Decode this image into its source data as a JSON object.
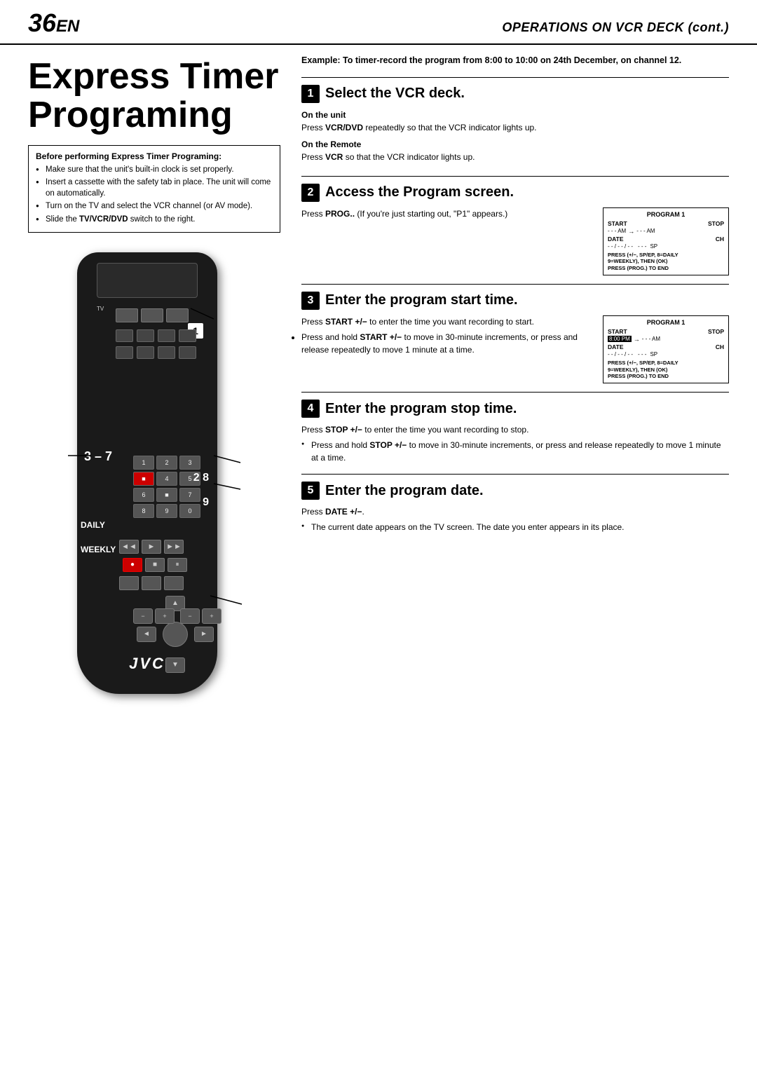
{
  "header": {
    "page_number": "36",
    "page_suffix": "EN",
    "section_title": "OPERATIONS ON VCR DECK (cont.)"
  },
  "page_title": "Express Timer\nPrograming",
  "before_box": {
    "title": "Before performing Express Timer Programing:",
    "items": [
      "Make sure that the unit's built-in clock is set properly.",
      "Insert a cassette with the safety tab in place. The unit will come on automatically.",
      "Turn on the TV and select the VCR channel (or AV mode).",
      "Slide the TV/VCR/DVD switch to the right."
    ]
  },
  "example_text": "Example: To timer-record the program from 8:00 to 10:00 on 24th December, on channel 12.",
  "remote": {
    "labels": {
      "tv": "TV",
      "num1": "1",
      "num3_7": "3 - 7",
      "num2_8": "2  8",
      "num9": "9",
      "daily": "DAILY",
      "weekly": "WEEKLY",
      "num8_bottom": "8",
      "jvc": "JVC"
    },
    "numpad": [
      "1",
      "2",
      "3",
      "4",
      "5",
      "6",
      "7",
      "8",
      "9",
      "0"
    ]
  },
  "steps": [
    {
      "number": "1",
      "title": "Select the VCR deck.",
      "sections": [
        {
          "subtitle": "On the unit",
          "text": "Press VCR/DVD repeatedly so that the VCR indicator lights up."
        },
        {
          "subtitle": "On the Remote",
          "text": "Press VCR so that the VCR indicator lights up."
        }
      ]
    },
    {
      "number": "2",
      "title": "Access the Program screen.",
      "text": "Press PROG.. (If you're just starting out, \"P1\" appears.)",
      "screen": {
        "title": "PROGRAM 1",
        "start_label": "START",
        "stop_label": "STOP",
        "date_label": "DATE",
        "ch_label": "CH",
        "start_val": "- - - AM",
        "stop_val": "- - - AM",
        "date_val": "- - / - - / - -",
        "ch_val": "- - -",
        "sp_val": "SP",
        "bottom": "PRESS (+/−, SP/EP, 8=DAILY\n9=WEEKLY), THEN (OK)\nPRESS (PROG.) TO END"
      }
    },
    {
      "number": "3",
      "title": "Enter the program start time.",
      "text": "Press START +/− to enter the time you want recording to start.",
      "bullets": [
        "Press and hold START +/− to move in 30-minute increments, or press and release repeatedly to move 1 minute at a time."
      ],
      "screen": {
        "title": "PROGRAM 1",
        "start_label": "START",
        "stop_label": "STOP",
        "date_label": "DATE",
        "ch_label": "CH",
        "start_val": "8:00 PM",
        "stop_val": "- - - AM",
        "date_val": "- - / - - / - -",
        "ch_val": "- - -",
        "sp_val": "SP",
        "bottom": "PRESS (+/−, SP/EP, 8=DAILY\n9=WEEKLY), THEN (OK)\nPRESS (PROG.) TO END"
      }
    },
    {
      "number": "4",
      "title": "Enter the program stop time.",
      "text": "Press STOP +/− to enter the time you want recording to stop.",
      "bullets": [
        "Press and hold STOP +/− to move in 30-minute increments, or press and release repeatedly to move 1 minute at a time."
      ]
    },
    {
      "number": "5",
      "title": "Enter the program date.",
      "text": "Press DATE +/−.",
      "bullets": [
        "The current date appears on the TV screen. The date you enter appears in its place."
      ]
    }
  ]
}
